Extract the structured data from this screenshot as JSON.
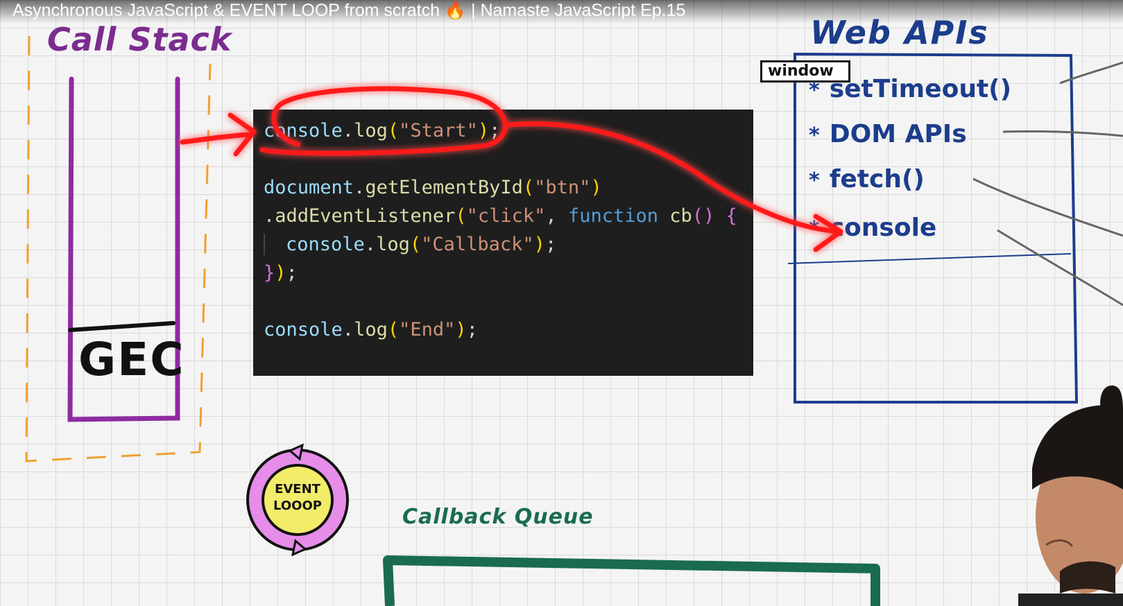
{
  "video": {
    "title": "Asynchronous JavaScript & EVENT LOOP from scratch 🔥 | Namaste JavaScript Ep.15"
  },
  "call_stack": {
    "title": "Call Stack",
    "context": "GEC"
  },
  "web_apis": {
    "title": "Web APIs",
    "window_label": "window",
    "items": [
      {
        "star": "*",
        "label": "setTimeout()"
      },
      {
        "star": "*",
        "label": "DOM APIs"
      },
      {
        "star": "*",
        "label": "fetch()"
      },
      {
        "star": "*",
        "label": "console"
      }
    ]
  },
  "event_loop": {
    "line1": "EVENT",
    "line2": "LOOOP"
  },
  "callback_queue": {
    "title": "Callback Queue"
  },
  "code": {
    "line1": {
      "obj": "console",
      "dot": ".",
      "fn": "log",
      "open": "(",
      "str": "\"Start\"",
      "close": ")",
      "end": ";"
    },
    "line2": {
      "obj": "document",
      "dot": ".",
      "fn": "getElementById",
      "open": "(",
      "str": "\"btn\"",
      "close": ")"
    },
    "line3": {
      "dot": ".",
      "fn": "addEventListener",
      "open": "(",
      "str": "\"click\"",
      "comma": ", ",
      "kw": "function",
      "name": " cb",
      "params": "()",
      "brace": " {"
    },
    "line4": {
      "obj": "console",
      "dot": ".",
      "fn": "log",
      "open": "(",
      "str": "\"Callback\"",
      "close": ")",
      "end": ";"
    },
    "line5": {
      "brace": "}",
      "close": ")",
      "end": ";"
    },
    "line6": {
      "obj": "console",
      "dot": ".",
      "fn": "log",
      "open": "(",
      "str": "\"End\"",
      "close": ")",
      "end": ";"
    }
  },
  "colors": {
    "call_stack": "#7b2c8f",
    "web_apis": "#1c3d8c",
    "callback_queue": "#1a6b52",
    "highlight": "#ff1a1a",
    "event_loop_ring": "#e58de8",
    "event_loop_core": "#f2ec6a"
  }
}
